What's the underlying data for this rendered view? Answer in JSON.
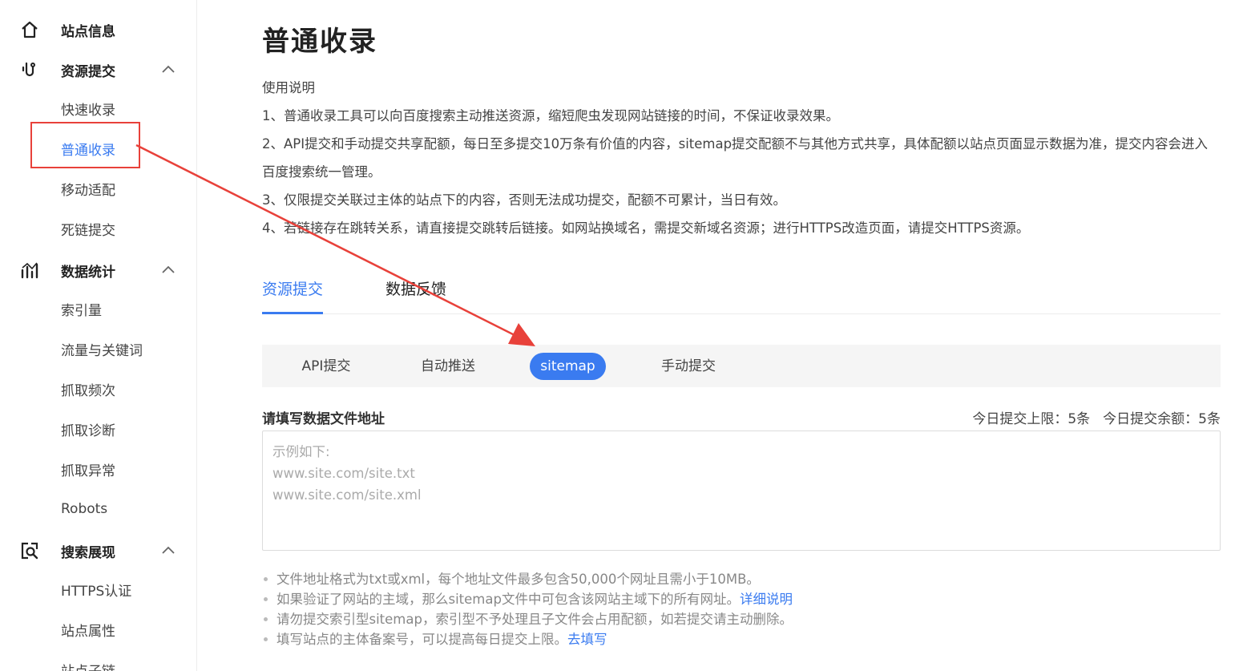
{
  "sidebar": {
    "groups": [
      {
        "label": "站点信息",
        "icon": "home-icon",
        "items": []
      },
      {
        "label": "资源提交",
        "icon": "hook-icon",
        "items": [
          "快速收录",
          "普通收录",
          "移动适配",
          "死链提交"
        ]
      },
      {
        "label": "数据统计",
        "icon": "chart-icon",
        "items": [
          "索引量",
          "流量与关键词",
          "抓取频次",
          "抓取诊断",
          "抓取异常",
          "Robots"
        ]
      },
      {
        "label": "搜索展现",
        "icon": "search-frame-icon",
        "items": [
          "HTTPS认证",
          "站点属性",
          "站点子链"
        ]
      }
    ],
    "active_item": "普通收录"
  },
  "page": {
    "title": "普通收录",
    "instructions_title": "使用说明",
    "instructions": [
      "1、普通收录工具可以向百度搜索主动推送资源，缩短爬虫发现网站链接的时间，不保证收录效果。",
      "2、API提交和手动提交共享配额，每日至多提交10万条有价值的内容，sitemap提交配额不与其他方式共享，具体配额以站点页面显示数据为准，提交内容会进入百度搜索统一管理。",
      "3、仅限提交关联过主体的站点下的内容，否则无法成功提交，配额不可累计，当日有效。",
      "4、若链接存在跳转关系，请直接提交跳转后链接。如网站换域名，需提交新域名资源；进行HTTPS改造页面，请提交HTTPS资源。"
    ]
  },
  "tabs": [
    {
      "label": "资源提交",
      "active": true
    },
    {
      "label": "数据反馈",
      "active": false
    }
  ],
  "subtabs": [
    {
      "label": "API提交",
      "active": false
    },
    {
      "label": "自动推送",
      "active": false
    },
    {
      "label": "sitemap",
      "active": true
    },
    {
      "label": "手动提交",
      "active": false
    }
  ],
  "form": {
    "label": "请填写数据文件地址",
    "quota_limit": "今日提交上限：5条",
    "quota_remaining": "今日提交余额：5条",
    "placeholder": "示例如下:\nwww.site.com/site.txt\nwww.site.com/site.xml",
    "value": ""
  },
  "notes": [
    {
      "text": "文件地址格式为txt或xml，每个地址文件最多包含50,000个网址且需小于10MB。",
      "link": ""
    },
    {
      "text": "如果验证了网站的主域，那么sitemap文件中可包含该网站主域下的所有网址。",
      "link": "详细说明"
    },
    {
      "text": "请勿提交索引型sitemap，索引型不予处理且子文件会占用配额，如若提交请主动删除。",
      "link": ""
    },
    {
      "text": "填写站点的主体备案号，可以提高每日提交上限。",
      "link": "去填写"
    }
  ],
  "annotation_color": "#e8413a",
  "accent_color": "#3a7bf0"
}
